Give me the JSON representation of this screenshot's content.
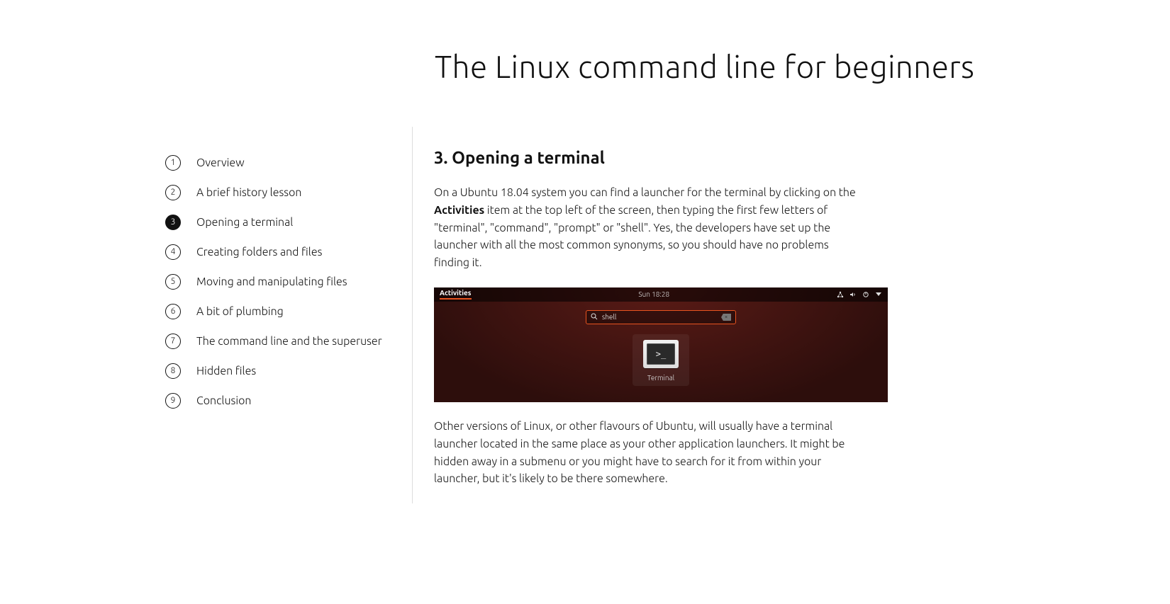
{
  "page": {
    "title": "The Linux command line for beginners"
  },
  "sidebar": {
    "items": [
      {
        "num": "1",
        "label": "Overview"
      },
      {
        "num": "2",
        "label": "A brief history lesson"
      },
      {
        "num": "3",
        "label": "Opening a terminal"
      },
      {
        "num": "4",
        "label": "Creating folders and files"
      },
      {
        "num": "5",
        "label": "Moving and manipulating files"
      },
      {
        "num": "6",
        "label": "A bit of plumbing"
      },
      {
        "num": "7",
        "label": "The command line and the superuser"
      },
      {
        "num": "8",
        "label": "Hidden files"
      },
      {
        "num": "9",
        "label": "Conclusion"
      }
    ],
    "activeIndex": 2
  },
  "content": {
    "heading": "3. Opening a terminal",
    "para1_before": "On a Ubuntu 18.04 system you can find a launcher for the terminal by clicking on the ",
    "para1_bold": "Activities",
    "para1_after": " item at the top left of the screen, then typing the first few letters of \"terminal\", \"command\", \"prompt\" or \"shell\". Yes, the developers have set up the launcher with all the most common synonyms, so you should have no problems finding it.",
    "para2": "Other versions of Linux, or other flavours of Ubuntu, will usually have a terminal launcher located in the same place as your other application launchers. It might be hidden away in a submenu or you might have to search for it from within your launcher, but it's likely to be there somewhere."
  },
  "screenshot": {
    "activities": "Activities",
    "clock": "Sun 18:28",
    "search": "shell",
    "app_label": "Terminal",
    "prompt_glyph": ">_"
  }
}
